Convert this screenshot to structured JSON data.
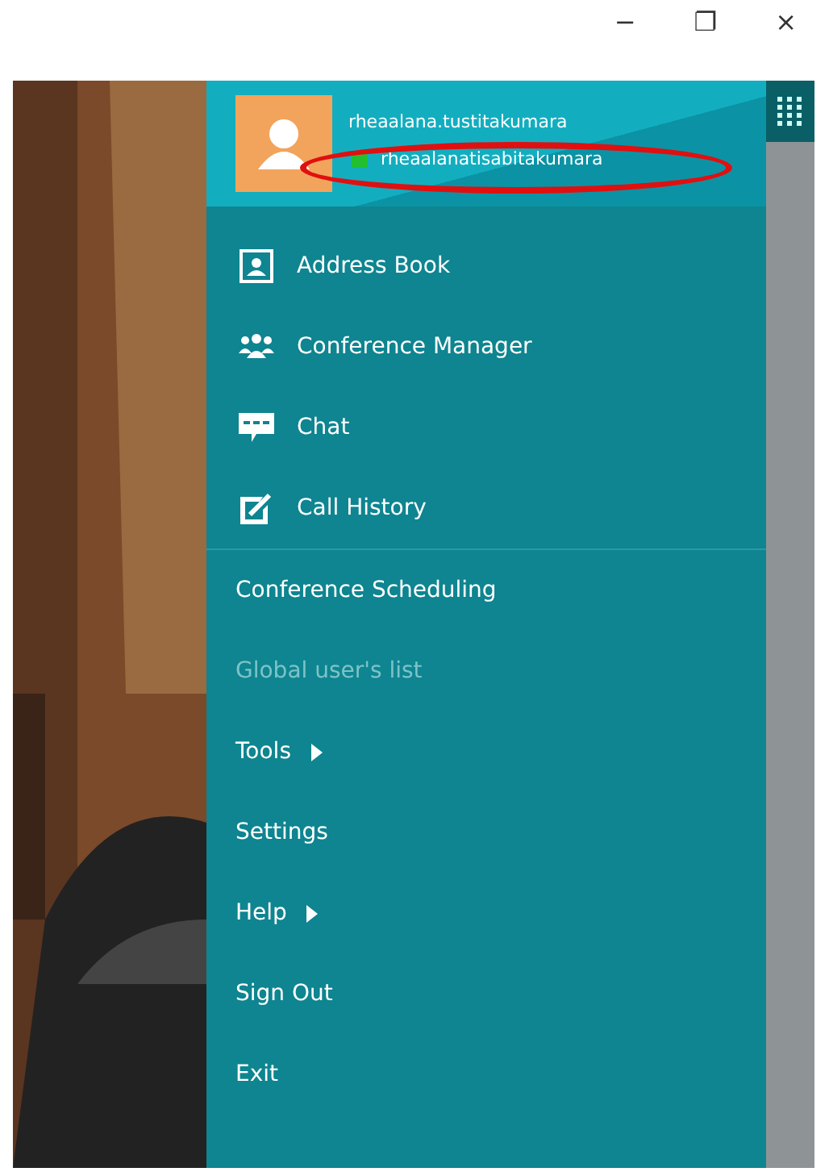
{
  "window": {
    "controls": [
      "−",
      "❐",
      "×"
    ]
  },
  "account": {
    "name": "rheaalana.tustitakumara",
    "status": {
      "name": "rheaalanatisabitakumara",
      "color": "#22c030"
    }
  },
  "annotation": {
    "kind": "ellipse",
    "color": "#e01010"
  },
  "menu": [
    {
      "label": "Address Book",
      "kind": "icon",
      "disabled": false,
      "submenu": false
    },
    {
      "label": "Conference Manager",
      "kind": "icon",
      "disabled": false,
      "submenu": false
    },
    {
      "label": "Chat",
      "kind": "icon",
      "disabled": false,
      "submenu": false
    },
    {
      "label": "Call History",
      "kind": "icon",
      "disabled": false,
      "submenu": false
    },
    {
      "label": "Conference Scheduling",
      "kind": "plain",
      "disabled": false,
      "submenu": false
    },
    {
      "label": "Global user's list",
      "kind": "plain",
      "disabled": true,
      "submenu": false
    },
    {
      "label": "Tools",
      "kind": "plain",
      "disabled": false,
      "submenu": true
    },
    {
      "label": "Settings",
      "kind": "plain",
      "disabled": false,
      "submenu": false
    },
    {
      "label": "Help",
      "kind": "plain",
      "disabled": false,
      "submenu": true
    },
    {
      "label": "Sign Out",
      "kind": "plain",
      "disabled": false,
      "submenu": false
    },
    {
      "label": "Exit",
      "kind": "plain",
      "disabled": false,
      "submenu": false
    }
  ]
}
